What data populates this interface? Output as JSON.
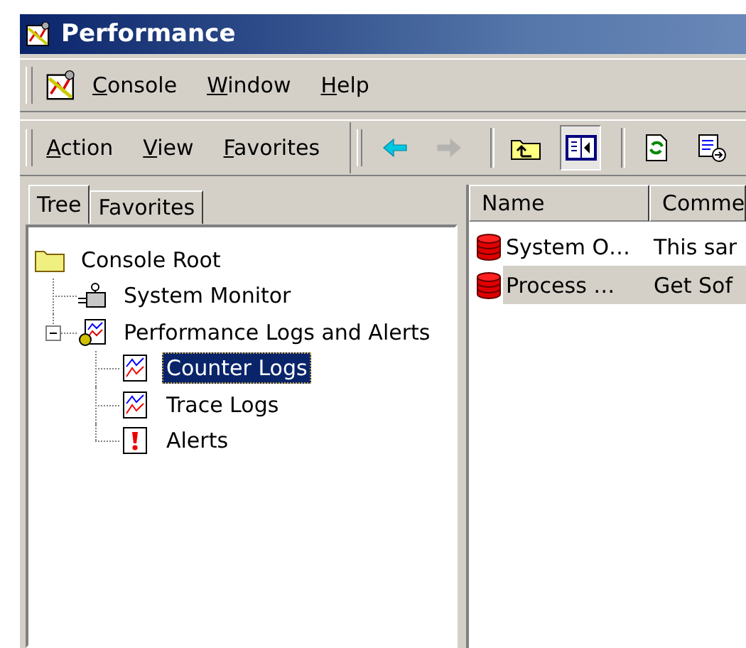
{
  "window": {
    "title": "Performance"
  },
  "menu": [
    {
      "label": "Console"
    },
    {
      "label": "Window"
    },
    {
      "label": "Help"
    }
  ],
  "action_menu": [
    {
      "label": "Action"
    },
    {
      "label": "View"
    },
    {
      "label": "Favorites"
    }
  ],
  "toolbar": [
    {
      "kind": "back",
      "disabled": false,
      "pressed": false
    },
    {
      "kind": "forward",
      "disabled": true,
      "pressed": false
    },
    {
      "kind": "up",
      "disabled": false,
      "pressed": false
    },
    {
      "kind": "tree",
      "disabled": false,
      "pressed": true
    },
    {
      "kind": "refresh",
      "disabled": false,
      "pressed": false
    },
    {
      "kind": "export",
      "disabled": false,
      "pressed": false
    }
  ],
  "tabs": [
    {
      "label": "Tree",
      "selected": true
    },
    {
      "label": "Favorites",
      "selected": false
    }
  ],
  "tree": {
    "items": [
      {
        "label": "Console Root",
        "kind": "folder",
        "selected": false,
        "children": [
          {
            "label": "System Monitor",
            "kind": "monitor",
            "selected": false
          },
          {
            "label": "Performance Logs and Alerts",
            "kind": "perf",
            "selected": false,
            "expanded": true,
            "children": [
              {
                "label": "Counter Logs",
                "kind": "chart",
                "selected": true
              },
              {
                "label": "Trace Logs",
                "kind": "chart",
                "selected": false
              },
              {
                "label": "Alerts",
                "kind": "alert",
                "selected": false
              }
            ]
          }
        ]
      }
    ]
  },
  "list": {
    "columns": [
      "Name",
      "Comme"
    ],
    "rows": [
      {
        "name": "System O…",
        "comment": "This sar",
        "selected": false
      },
      {
        "name": "Process …",
        "comment": "Get Sof",
        "selected": true
      }
    ]
  }
}
